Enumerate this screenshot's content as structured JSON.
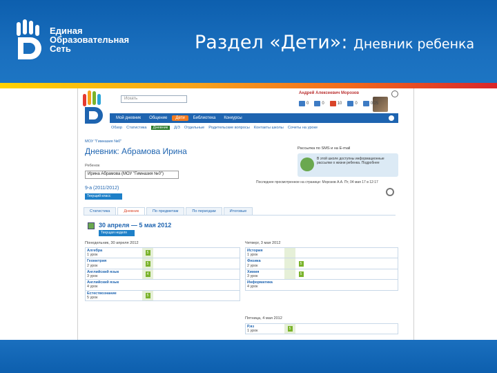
{
  "slide": {
    "logo_lines": [
      "Единая",
      "Образовательная",
      "Сеть"
    ],
    "title_main": "Раздел «Дети»: ",
    "title_sub": "Дневник ребенка"
  },
  "site": {
    "search_placeholder": "Искать",
    "user_name": "Андрей Алексеевич Морозов",
    "counters": [
      {
        "icon": "mail-icon",
        "value": "0"
      },
      {
        "icon": "friends-icon",
        "value": "0"
      },
      {
        "icon": "events-icon",
        "value": "10"
      },
      {
        "icon": "photo-icon",
        "value": "0"
      },
      {
        "icon": "msg-icon",
        "value": "0/25"
      }
    ],
    "nav": [
      "Мой дневник",
      "Общение",
      "Дети",
      "Библиотека",
      "Конкурсы"
    ],
    "nav_active": 2,
    "subnav": [
      "Обзор",
      "Статистика",
      "Дневник",
      "Д/З",
      "Отдельные",
      "Родительские вопросы",
      "Контакты школы",
      "Сочеты на уроке"
    ],
    "subnav_active": 2
  },
  "diary": {
    "school": "МОУ \"Гимназия №0\"",
    "title": "Дневник: Абрамова Ирина",
    "child_label": "Ребенок",
    "child_value": "Ирина Абрамова (МОУ \"Гимназия №0\")",
    "year": "9-а (2011/2012)",
    "year_button": "Текущий класс",
    "sms_title": "Рассылка по SMS и на E-mail",
    "sms_text": "В этой школе доступны информационные рассылки о жизни ребенка. Подробнее",
    "last_update": "Последнее просмотренное на странице: Морозов А.А. Пт, 04 мая 17 в 12:17",
    "tabs": [
      "Статистика",
      "Дневник",
      "По предметам",
      "По периодам",
      "Итоговые"
    ],
    "tab_active": 1,
    "week_range": "30 апреля — 5 мая 2012",
    "week_button": "Текущая неделя"
  },
  "days": [
    {
      "title": "Понедельник, 30 апреля 2012",
      "lessons": [
        {
          "subject": "Алгебра",
          "num": "1 урок",
          "grade": "5"
        },
        {
          "subject": "Геометрия",
          "num": "2 урок",
          "grade": "5"
        },
        {
          "subject": "Английский язык",
          "num": "3 урок",
          "grade": "4"
        },
        {
          "subject": "Английский язык",
          "num": "4 урок",
          "grade": ""
        },
        {
          "subject": "Естествознание",
          "num": "5 урок",
          "grade": "5"
        }
      ]
    },
    {
      "title": "Четверг, 3 мая 2012",
      "lessons": [
        {
          "subject": "История",
          "num": "1 урок",
          "grade": ""
        },
        {
          "subject": "Физика",
          "num": "2 урок",
          "grade": "5"
        },
        {
          "subject": "Химия",
          "num": "3 урок",
          "grade": "5"
        },
        {
          "subject": "Информатика",
          "num": "4 урок",
          "grade": ""
        }
      ]
    },
    {
      "title": "Пятница, 4 мая 2012",
      "lessons": [
        {
          "subject": "Р.яз",
          "num": "1 урок",
          "grade": "5"
        }
      ]
    }
  ],
  "colors": {
    "header_blue": "#0d5fae",
    "link_blue": "#1e64b0",
    "accent_orange": "#f47b20",
    "grade_green": "#7ab32a"
  }
}
